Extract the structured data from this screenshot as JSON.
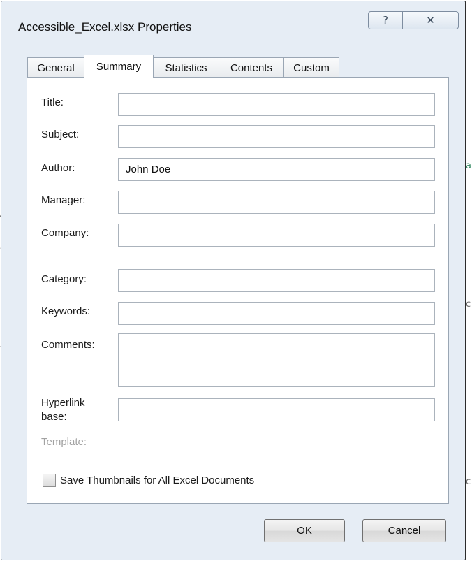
{
  "window": {
    "title": "Accessible_Excel.xlsx Properties"
  },
  "title_buttons": {
    "help": "?",
    "close": "✕"
  },
  "tabs": [
    {
      "label": "General",
      "active": false
    },
    {
      "label": "Summary",
      "active": true
    },
    {
      "label": "Statistics",
      "active": false
    },
    {
      "label": "Contents",
      "active": false
    },
    {
      "label": "Custom",
      "active": false
    }
  ],
  "fields": {
    "title": {
      "label": "Title:",
      "value": ""
    },
    "subject": {
      "label": "Subject:",
      "value": ""
    },
    "author": {
      "label": "Author:",
      "value": "John Doe"
    },
    "manager": {
      "label": "Manager:",
      "value": ""
    },
    "company": {
      "label": "Company:",
      "value": ""
    },
    "category": {
      "label": "Category:",
      "value": ""
    },
    "keywords": {
      "label": "Keywords:",
      "value": ""
    },
    "comments": {
      "label": "Comments:",
      "value": ""
    },
    "hyperlink_base": {
      "label_line1": "Hyperlink",
      "label_line2": "base:",
      "value": ""
    },
    "template": {
      "label": "Template:"
    }
  },
  "save_thumbnails": {
    "label": "Save Thumbnails for All Excel Documents",
    "checked": false
  },
  "buttons": {
    "ok": "OK",
    "cancel": "Cancel"
  }
}
